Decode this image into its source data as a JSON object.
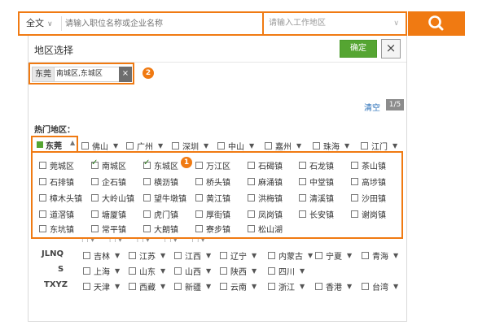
{
  "search": {
    "scope_label": "全文",
    "keyword_placeholder": "请输入职位名称或企业名称",
    "location_placeholder": "请输入工作地区"
  },
  "dialog": {
    "title": "地区选择",
    "confirm_label": "确定",
    "close_label": "×"
  },
  "selected": {
    "city": "东莞",
    "districts": "南城区,东城区",
    "remove_label": "×",
    "badge": "2"
  },
  "toolbar": {
    "clear_label": "清空",
    "count": "1/5"
  },
  "hot_label": "热门地区：",
  "hot_cities": [
    {
      "name": "东莞",
      "active": true
    },
    {
      "name": "佛山"
    },
    {
      "name": "广州"
    },
    {
      "name": "深圳"
    },
    {
      "name": "中山"
    },
    {
      "name": "嘉州"
    },
    {
      "name": "珠海"
    },
    {
      "name": "江门"
    }
  ],
  "district_badge": "1",
  "districts": [
    [
      {
        "name": "莞城区"
      },
      {
        "name": "南城区",
        "checked": true
      },
      {
        "name": "东城区",
        "checked": true
      },
      {
        "name": "万江区"
      },
      {
        "name": "石碣镇"
      },
      {
        "name": "石龙镇"
      },
      {
        "name": "茶山镇"
      }
    ],
    [
      {
        "name": "石排镇"
      },
      {
        "name": "企石镇"
      },
      {
        "name": "横沥镇"
      },
      {
        "name": "桥头镇"
      },
      {
        "name": "麻涌镇"
      },
      {
        "name": "中堂镇"
      },
      {
        "name": "高埗镇"
      }
    ],
    [
      {
        "name": "樟木头镇"
      },
      {
        "name": "大岭山镇"
      },
      {
        "name": "望牛墩镇"
      },
      {
        "name": "黄江镇"
      },
      {
        "name": "洪梅镇"
      },
      {
        "name": "清溪镇"
      },
      {
        "name": "沙田镇"
      }
    ],
    [
      {
        "name": "道滘镇"
      },
      {
        "name": "塘厦镇"
      },
      {
        "name": "虎门镇"
      },
      {
        "name": "厚街镇"
      },
      {
        "name": "凤岗镇"
      },
      {
        "name": "长安镇"
      },
      {
        "name": "谢岗镇"
      }
    ],
    [
      {
        "name": "东坑镇"
      },
      {
        "name": "常平镇"
      },
      {
        "name": "大朗镇"
      },
      {
        "name": "寮步镇"
      },
      {
        "name": "松山湖"
      }
    ]
  ],
  "province_rows": [
    {
      "label": "JLNQ",
      "items": [
        "吉林",
        "江苏",
        "江西",
        "辽宁",
        "内蒙古",
        "宁夏",
        "青海"
      ]
    },
    {
      "label": "S",
      "items": [
        "上海",
        "山东",
        "山西",
        "陕西",
        "四川"
      ]
    },
    {
      "label": "TXYZ",
      "items": [
        "天津",
        "西藏",
        "新疆",
        "云南",
        "浙江",
        "香港",
        "台湾"
      ]
    }
  ]
}
